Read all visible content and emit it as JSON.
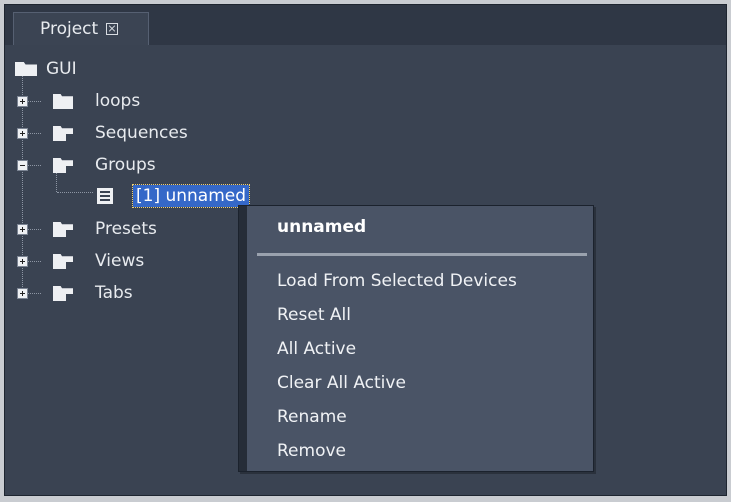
{
  "panel": {
    "tab_label": "Project",
    "tab_close_icon": "close-box-icon"
  },
  "tree": {
    "root": {
      "label": "GUI",
      "icon": "folder-open-icon",
      "expanded": true
    },
    "items": [
      {
        "label": "loops",
        "icon": "folder-icon",
        "expanded": false
      },
      {
        "label": "Sequences",
        "icon": "folder-sequence-icon",
        "expanded": false
      },
      {
        "label": "Groups",
        "icon": "folder-groups-icon",
        "expanded": true,
        "children": [
          {
            "label": "[1] unnamed",
            "icon": "group-list-icon",
            "selected": true
          }
        ]
      },
      {
        "label": "Presets",
        "icon": "folder-presets-icon",
        "expanded": false
      },
      {
        "label": "Views",
        "icon": "folder-views-icon",
        "expanded": false
      },
      {
        "label": "Tabs",
        "icon": "folder-tabs-icon",
        "expanded": false
      }
    ]
  },
  "context_menu": {
    "title": "unnamed",
    "items": [
      "Load From Selected Devices",
      "Reset All",
      "All Active",
      "Clear All Active",
      "Rename",
      "Remove"
    ]
  },
  "colors": {
    "panel_bg": "#3a4352",
    "menu_bg": "#4a5466",
    "selection": "#3568c8"
  }
}
